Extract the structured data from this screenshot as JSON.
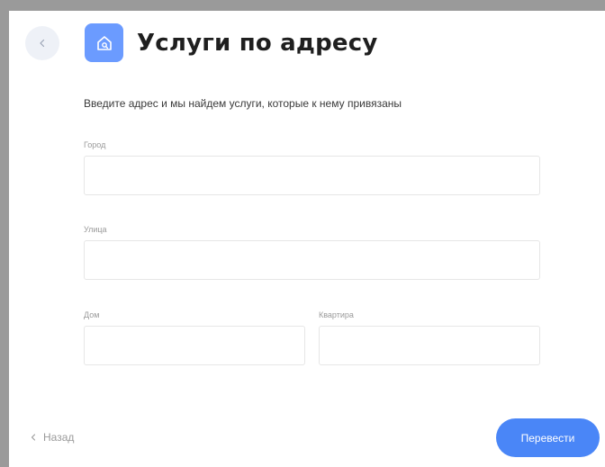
{
  "header": {
    "title": "Услуги по адресу",
    "back_icon": "chevron-left-icon",
    "service_icon": "house-search-icon"
  },
  "form": {
    "subtitle": "Введите адрес и мы найдем услуги, которые к нему привязаны",
    "city": {
      "label": "Город",
      "value": ""
    },
    "street": {
      "label": "Улица",
      "value": ""
    },
    "house": {
      "label": "Дом",
      "value": ""
    },
    "apartment": {
      "label": "Квартира",
      "value": ""
    }
  },
  "footer": {
    "back_label": "Назад",
    "submit_label": "Перевести"
  },
  "colors": {
    "accent": "#4a86f7",
    "icon_bg": "#6b9bff"
  }
}
